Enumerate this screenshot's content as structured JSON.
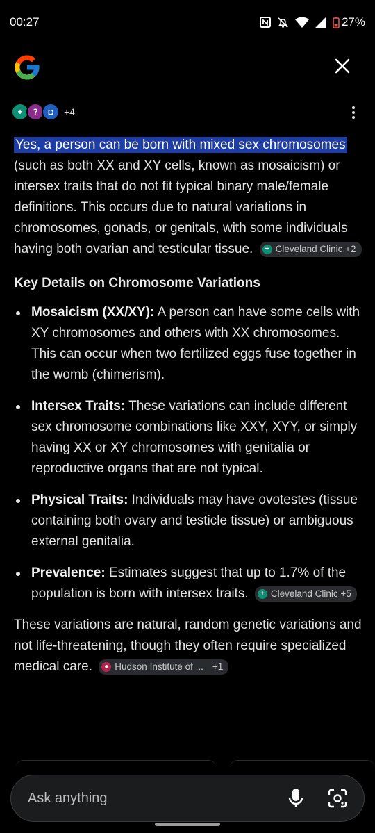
{
  "status": {
    "time": "00:27",
    "battery": "27%"
  },
  "sources": {
    "count_label": "+4"
  },
  "answer": {
    "intro_highlight": "Yes, a person can be born with mixed sex chromosomes",
    "intro_rest": " (such as both XX and XY cells, known as mosaicism) or intersex traits that do not fit typical binary male/female definitions. This occurs due to natural variations in chromosomes, gonads, or genitals, with some individuals having both ovarian and testicular tissue.",
    "intro_chip": "Cleveland Clinic +2",
    "heading": "Key Details on Chromosome Variations",
    "bullets": [
      {
        "title": "Mosaicism (XX/XY):",
        "text": " A person can have some cells with XY chromosomes and others with XX chromosomes. This can occur when two fertilized eggs fuse together in the womb (chimerism)."
      },
      {
        "title": "Intersex Traits:",
        "text": " These variations can include different sex chromosome combinations like XXY, XYY, or simply having XX or XY chromosomes with genitalia or reproductive organs that are not typical."
      },
      {
        "title": "Physical Traits:",
        "text": " Individuals may have ovotestes (tissue containing both ovary and testicle tissue) or ambiguous external genitalia."
      },
      {
        "title": "Prevalence:",
        "text": " Estimates suggest that up to 1.7% of the population is born with intersex traits.",
        "chip": "Cleveland Clinic +5"
      }
    ],
    "closing": "These variations are natural, random genetic variations and not life-threatening, though they often require specialized medical care.",
    "closing_chip_name": "Hudson Institute of ...",
    "closing_chip_count": "+1"
  },
  "askbar": {
    "placeholder": "Ask anything"
  },
  "colors": {
    "highlight": "#1e3ea6",
    "chip_bg": "#2a2b2e",
    "background": "#000000"
  },
  "icons": [
    "google-logo",
    "close-icon",
    "more-vert-icon",
    "mic-icon",
    "lens-icon",
    "nfc-icon",
    "bell-off-icon",
    "wifi-icon",
    "signal-icon",
    "battery-icon"
  ]
}
